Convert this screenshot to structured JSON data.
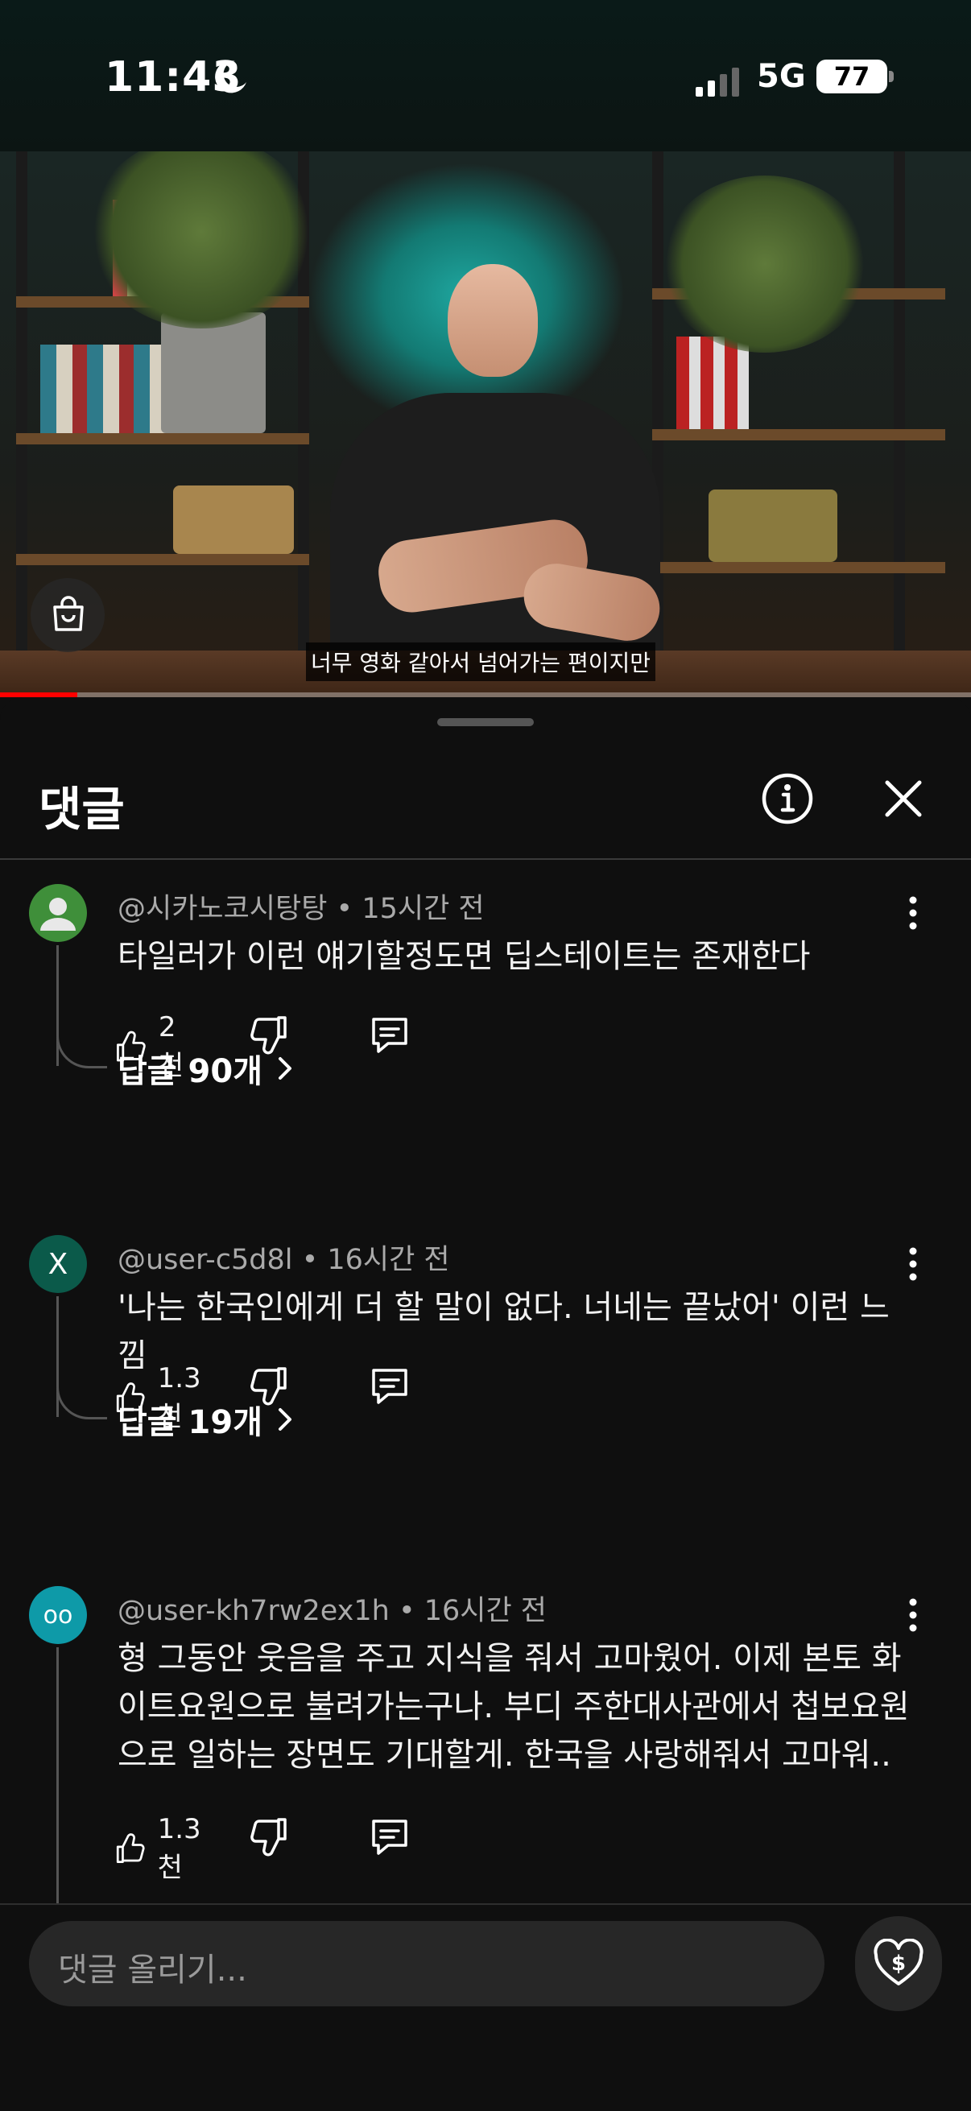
{
  "status_bar": {
    "time": "11:43",
    "network": "5G",
    "battery": "77"
  },
  "video": {
    "caption": "너무 영화 같아서 넘어가는 편이지만",
    "progress": 0.08
  },
  "sheet": {
    "title": "댓글"
  },
  "comments": [
    {
      "author": "@시카노코시탕탕",
      "time": "15시간 전",
      "text": "타일러가 이런 얘기할정도면 딥스테이트는 존재한다",
      "likes": "2천",
      "replies": "답글 90개",
      "avatar_color": "#3f8f3a"
    },
    {
      "author": "@user-c5d8l",
      "time": "16시간 전",
      "text": "'나는 한국인에게 더 할 말이 없다. 너네는 끝났어' 이런 느낌",
      "likes": "1.3천",
      "replies": "답글 19개",
      "avatar_letter": "X",
      "avatar_color": "#0b5a4a"
    },
    {
      "author": "@user-kh7rw2ex1h",
      "time": "16시간 전",
      "text": "형 그동안 웃음을 주고 지식을 줘서 고마웠어. 이제 본토 화이트요원으로 불려가는구나. 부디 주한대사관에서 첩보요원으로 일하는 장면도 기대할게. 한국을 사랑해줘서 고마워..",
      "likes": "1.3천",
      "avatar_letter": "oo",
      "avatar_color": "#0e9aa8"
    }
  ],
  "composer": {
    "placeholder": "댓글 올리기..."
  }
}
